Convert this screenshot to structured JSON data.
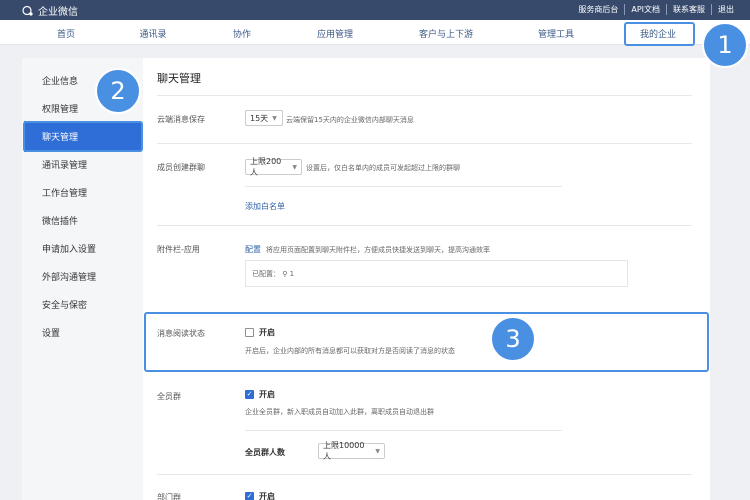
{
  "topbar": {
    "brand": "企业微信",
    "links": [
      "服务商后台",
      "API文档",
      "联系客服",
      "退出"
    ]
  },
  "nav": {
    "items": [
      "首页",
      "通讯录",
      "协作",
      "应用管理",
      "客户与上下游",
      "管理工具",
      "我的企业"
    ]
  },
  "sidebar": {
    "items": [
      "企业信息",
      "权限管理",
      "聊天管理",
      "通讯录管理",
      "工作台管理",
      "微信插件",
      "申请加入设置",
      "外部沟通管理",
      "安全与保密",
      "设置"
    ]
  },
  "main": {
    "title": "聊天管理",
    "cloud_storage": {
      "label": "云端消息保存",
      "value": "15天",
      "hint": "云端保留15天内的企业微信内部聊天消息"
    },
    "member_group": {
      "label": "成员创建群聊",
      "value": "上限200人",
      "hint": "设置后，仅白名单内的成员可发起超过上限的群聊",
      "whitelist_link": "添加白名单"
    },
    "attachment": {
      "label": "附件栏-应用",
      "config_link": "配置",
      "hint": "将应用页面配置到聊天附件栏，方便成员快捷发送到聊天，提高沟通效率",
      "configured_prefix": "已配置：",
      "configured_count": "1"
    },
    "read_status": {
      "label": "消息阅读状态",
      "option": "开启",
      "checked": false,
      "hint": "开启后，企业内部的所有消息都可以获取对方是否阅读了消息的状态"
    },
    "all_staff": {
      "label": "全员群",
      "option": "开启",
      "checked": true,
      "hint": "企业全员群，新入职成员自动加入此群，离职成员自动退出群",
      "count_label": "全员群人数",
      "count_value": "上限10000人"
    },
    "dept_group": {
      "label": "部门群",
      "option": "开启",
      "checked": true
    }
  },
  "annotations": [
    "1",
    "2",
    "3"
  ],
  "colors": {
    "topbar": "#374a6b",
    "accent": "#2f6ed6",
    "highlight": "#4a90e2"
  }
}
